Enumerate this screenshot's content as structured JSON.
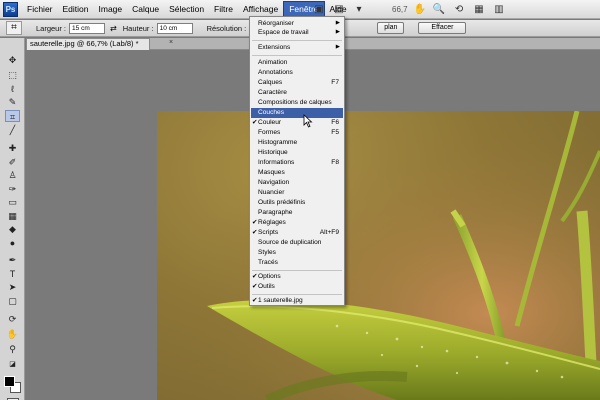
{
  "menubar": {
    "logo": "Ps",
    "items": [
      "Fichier",
      "Edition",
      "Image",
      "Calque",
      "Sélection",
      "Filtre",
      "Affichage",
      "Fenêtre",
      "Aide"
    ],
    "active_index": 7,
    "zoom": "66,7",
    "icons": [
      "bridge-icon",
      "minibridge-icon",
      "hand-tool-icon",
      "zoom-tool-icon",
      "rotate-view-icon",
      "grid-icon",
      "arrange-icon"
    ]
  },
  "options": {
    "largeur_label": "Largeur :",
    "largeur_value": "15 cm",
    "hauteur_label": "Hauteur :",
    "hauteur_value": "10 cm",
    "resolution_label": "Résolution :",
    "front_button": "plan",
    "clear_button": "Effacer"
  },
  "document": {
    "tab_title": "sauterelle.jpg @ 66,7% (Lab/8) *",
    "close": "×"
  },
  "fenetre_menu": {
    "rows": [
      {
        "label": "Réorganiser",
        "shortcut": "",
        "checked": false,
        "submenu": true,
        "highlighted": false
      },
      {
        "label": "Espace de travail",
        "shortcut": "",
        "checked": false,
        "submenu": true,
        "highlighted": false
      },
      {
        "label": "Extensions",
        "shortcut": "",
        "checked": false,
        "submenu": true,
        "highlighted": false
      },
      {
        "label": "Animation",
        "shortcut": "",
        "checked": false,
        "submenu": false,
        "highlighted": false
      },
      {
        "label": "Annotations",
        "shortcut": "",
        "checked": false,
        "submenu": false,
        "highlighted": false
      },
      {
        "label": "Calques",
        "shortcut": "F7",
        "checked": false,
        "submenu": false,
        "highlighted": false
      },
      {
        "label": "Caractère",
        "shortcut": "",
        "checked": false,
        "submenu": false,
        "highlighted": false
      },
      {
        "label": "Compositions de calques",
        "shortcut": "",
        "checked": false,
        "submenu": false,
        "highlighted": false
      },
      {
        "label": "Couches",
        "shortcut": "",
        "checked": false,
        "submenu": false,
        "highlighted": true
      },
      {
        "label": "Couleur",
        "shortcut": "F6",
        "checked": true,
        "submenu": false,
        "highlighted": false
      },
      {
        "label": "Formes",
        "shortcut": "F5",
        "checked": false,
        "submenu": false,
        "highlighted": false
      },
      {
        "label": "Histogramme",
        "shortcut": "",
        "checked": false,
        "submenu": false,
        "highlighted": false
      },
      {
        "label": "Historique",
        "shortcut": "",
        "checked": false,
        "submenu": false,
        "highlighted": false
      },
      {
        "label": "Informations",
        "shortcut": "F8",
        "checked": false,
        "submenu": false,
        "highlighted": false
      },
      {
        "label": "Masques",
        "shortcut": "",
        "checked": false,
        "submenu": false,
        "highlighted": false
      },
      {
        "label": "Navigation",
        "shortcut": "",
        "checked": false,
        "submenu": false,
        "highlighted": false
      },
      {
        "label": "Nuancier",
        "shortcut": "",
        "checked": false,
        "submenu": false,
        "highlighted": false
      },
      {
        "label": "Outils prédéfinis",
        "shortcut": "",
        "checked": false,
        "submenu": false,
        "highlighted": false
      },
      {
        "label": "Paragraphe",
        "shortcut": "",
        "checked": false,
        "submenu": false,
        "highlighted": false
      },
      {
        "label": "Réglages",
        "shortcut": "",
        "checked": true,
        "submenu": false,
        "highlighted": false
      },
      {
        "label": "Scripts",
        "shortcut": "Alt+F9",
        "checked": true,
        "submenu": false,
        "highlighted": false
      },
      {
        "label": "Source de duplication",
        "shortcut": "",
        "checked": false,
        "submenu": false,
        "highlighted": false
      },
      {
        "label": "Styles",
        "shortcut": "",
        "checked": false,
        "submenu": false,
        "highlighted": false
      },
      {
        "label": "Tracés",
        "shortcut": "",
        "checked": false,
        "submenu": false,
        "highlighted": false
      },
      {
        "label": "Options",
        "shortcut": "",
        "checked": true,
        "submenu": false,
        "highlighted": false
      },
      {
        "label": "Outils",
        "shortcut": "",
        "checked": true,
        "submenu": false,
        "highlighted": false
      },
      {
        "label": "1 sauterelle.jpg",
        "shortcut": "",
        "checked": true,
        "submenu": false,
        "highlighted": false
      }
    ]
  },
  "tools": [
    "move-tool-icon",
    "marquee-tool-icon",
    "lasso-tool-icon",
    "quick-select-tool-icon",
    "crop-tool-icon",
    "eyedropper-tool-icon",
    "healing-brush-tool-icon",
    "brush-tool-icon",
    "clone-stamp-tool-icon",
    "history-brush-tool-icon",
    "eraser-tool-icon",
    "gradient-tool-icon",
    "blur-tool-icon",
    "dodge-tool-icon",
    "pen-tool-icon",
    "type-tool-icon",
    "path-select-tool-icon",
    "shape-tool-icon",
    "3d-rotate-tool-icon",
    "hand-tool-icon",
    "zoom-tool-icon"
  ],
  "selected_tool_index": 4,
  "colors": {
    "menu_highlight": "#3c5fa8",
    "foreground": "#000000",
    "background": "#ffffff"
  }
}
